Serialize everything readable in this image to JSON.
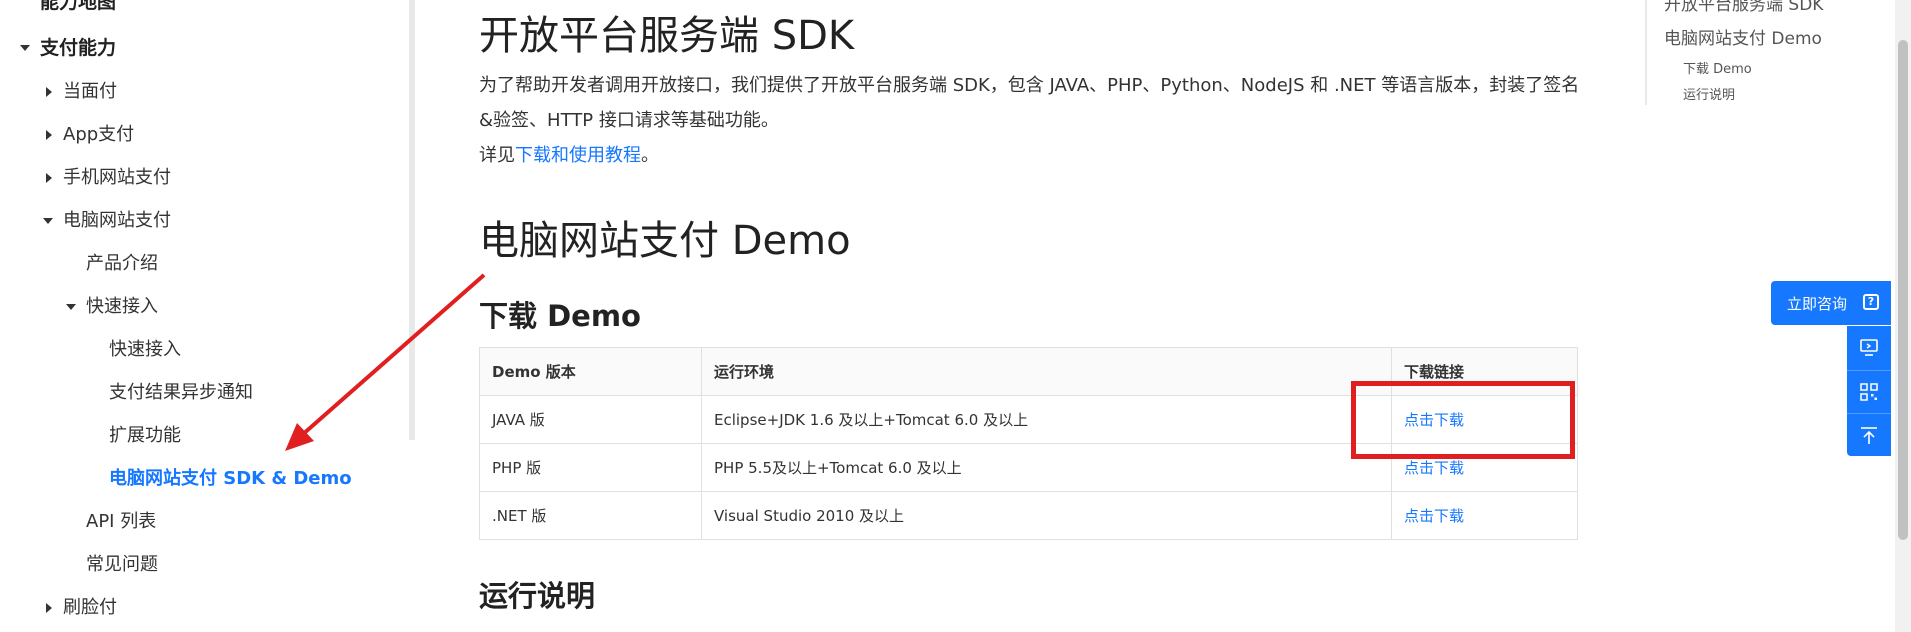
{
  "sidebar": {
    "items": [
      {
        "label": "能力地图"
      },
      {
        "label": "支付能力"
      },
      {
        "label": "当面付"
      },
      {
        "label": "App支付"
      },
      {
        "label": "手机网站支付"
      },
      {
        "label": "电脑网站支付"
      },
      {
        "label": "产品介绍"
      },
      {
        "label": "快速接入"
      },
      {
        "label": "快速接入"
      },
      {
        "label": "支付结果异步通知"
      },
      {
        "label": "扩展功能"
      },
      {
        "label": "电脑网站支付 SDK & Demo"
      },
      {
        "label": "API 列表"
      },
      {
        "label": "常见问题"
      },
      {
        "label": "刷脸付"
      }
    ]
  },
  "main": {
    "sdk_title": "开放平台服务端 SDK",
    "sdk_para": "为了帮助开发者调用开放接口，我们提供了开放平台服务端 SDK，包含 JAVA、PHP、Python、NodeJS 和 .NET 等语言版本，封装了签名&验签、HTTP 接口请求等基础功能。",
    "see_prefix": "详见",
    "see_link": "下载和使用教程",
    "see_suffix": "。",
    "demo_title": "电脑网站支付 Demo",
    "download_title": "下载 Demo",
    "run_title": "运行说明",
    "table": {
      "headers": [
        "Demo 版本",
        "运行环境",
        "下载链接"
      ],
      "rows": [
        {
          "version": "JAVA 版",
          "env": "Eclipse+JDK 1.6 及以上+Tomcat 6.0 及以上",
          "link": "点击下载"
        },
        {
          "version": "PHP 版",
          "env": "PHP 5.5及以上+Tomcat 6.0 及以上",
          "link": "点击下载"
        },
        {
          "version": ".NET 版",
          "env": "Visual Studio 2010 及以上",
          "link": "点击下载"
        }
      ]
    }
  },
  "toc": {
    "items": [
      {
        "label": "开放平台服务端 SDK"
      },
      {
        "label": "电脑网站支付 Demo"
      },
      {
        "label": "下载 Demo"
      },
      {
        "label": "运行说明"
      }
    ]
  },
  "widgets": {
    "consult_label": "立即咨询"
  },
  "colors": {
    "accent": "#1677ff",
    "annotation": "#e02020"
  }
}
